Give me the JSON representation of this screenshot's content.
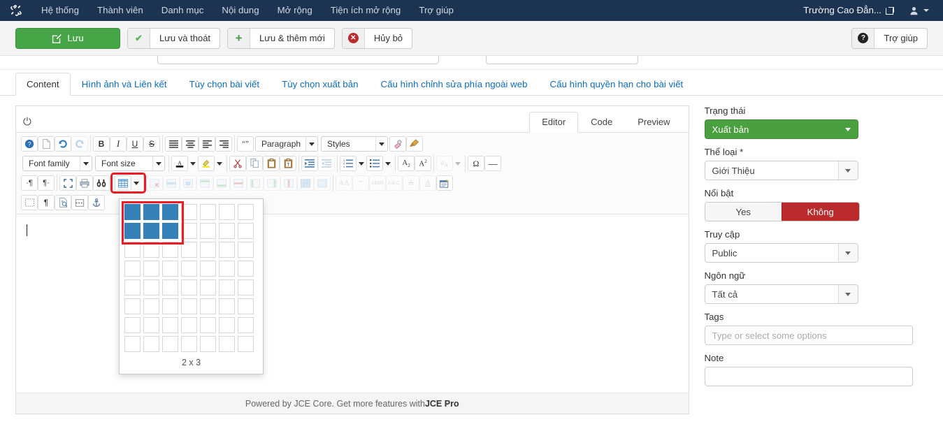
{
  "topbar": {
    "logo_icon": "joomla-logo-icon",
    "menu": [
      {
        "label": "Hệ thống"
      },
      {
        "label": "Thành viên"
      },
      {
        "label": "Danh mục"
      },
      {
        "label": "Nội dung"
      },
      {
        "label": "Mở rộng"
      },
      {
        "label": "Tiện ích mở rộng"
      },
      {
        "label": "Trợ giúp"
      }
    ],
    "site_name": "Trường Cao Đẳn...",
    "site_link_icon": "external-link-icon",
    "user_icon": "user-icon"
  },
  "toolbar": {
    "save_label": "Lưu",
    "save_close_label": "Lưu và thoát",
    "save_new_label": "Lưu & thêm mới",
    "cancel_label": "Hủy bỏ",
    "help_label": "Trợ giúp",
    "save_icon": "pencil-square-icon",
    "save_close_icon": "check-icon",
    "save_new_icon": "plus-icon",
    "cancel_icon": "cancel-circle-icon",
    "help_icon": "question-circle-icon",
    "accent_green": "#46a546",
    "accent_red": "#bb2b2b"
  },
  "tabs": [
    {
      "label": "Content",
      "active": true
    },
    {
      "label": "Hình ảnh và Liên kết",
      "active": false
    },
    {
      "label": "Tùy chọn bài viết",
      "active": false
    },
    {
      "label": "Tùy chọn xuất bản",
      "active": false
    },
    {
      "label": "Cấu hình chỉnh sửa phía ngoài web",
      "active": false
    },
    {
      "label": "Cấu hình quyền hạn cho bài viết",
      "active": false
    }
  ],
  "editor": {
    "power_icon": "power-toggle-icon",
    "mode_tabs": [
      {
        "label": "Editor",
        "active": true
      },
      {
        "label": "Code",
        "active": false
      },
      {
        "label": "Preview",
        "active": false
      }
    ],
    "selects": {
      "paragraph": "Paragraph",
      "styles": "Styles",
      "font_family": "Font family",
      "font_size": "Font size"
    },
    "footer_text": "Powered by JCE Core. Get more features with ",
    "footer_link": "JCE Pro",
    "content": "",
    "toolbar_rows": [
      {
        "buttons": [
          "help-icon",
          "new-document-icon",
          "undo-icon",
          "redo-icon",
          "bold-icon",
          "italic-icon",
          "underline-icon",
          "strikethrough-icon",
          "align-justify-icon",
          "align-center-icon",
          "align-left-icon",
          "align-right-icon",
          "blockquote-icon",
          "paragraph-select",
          "styles-select",
          "remove-format-icon",
          "clean-up-icon"
        ]
      },
      {
        "buttons": [
          "font-family-select",
          "font-size-select",
          "forecolor-icon",
          "forecolor-caret",
          "backcolor-icon",
          "backcolor-caret",
          "cut-icon",
          "copy-icon",
          "paste-icon",
          "paste-text-icon",
          "indent-icon",
          "outdent-icon",
          "numbered-list-icon",
          "numbered-list-caret",
          "bullet-list-icon",
          "bullet-list-caret",
          "subscript-icon",
          "superscript-icon",
          "spellcheck-icon",
          "spellcheck-caret",
          "charmap-icon",
          "horizontal-rule-icon"
        ]
      },
      {
        "buttons": [
          "ltr-icon",
          "rtl-icon",
          "fullscreen-icon",
          "print-icon",
          "search-replace-icon",
          "table-icon",
          "table-caret",
          "delete-table-icon",
          "row-properties-icon",
          "cell-properties-icon",
          "insert-row-before-icon",
          "insert-row-after-icon",
          "delete-row-icon",
          "insert-col-before-icon",
          "insert-col-after-icon",
          "delete-col-icon",
          "merge-cells-icon",
          "split-cells-icon",
          "style-select-icon",
          "quote-icon",
          "abbr-icon",
          "acronym-icon",
          "delete-text-icon",
          "insert-text-icon",
          "article-icon"
        ]
      },
      {
        "buttons": [
          "visual-blocks-icon",
          "pilcrow-icon",
          "preview-page-icon",
          "page-break-icon",
          "anchor-icon"
        ]
      }
    ],
    "table_picker": {
      "rows": 8,
      "cols": 7,
      "selected_rows": 2,
      "selected_cols": 3,
      "label": "2 x 3",
      "highlight_color": "#3580b8",
      "annotation_color": "#ec1c24"
    }
  },
  "sidebar": {
    "status": {
      "label": "Trạng thái",
      "value": "Xuất bản"
    },
    "category": {
      "label": "Thể loại *",
      "value": "Giới Thiệu"
    },
    "featured": {
      "label": "Nổi bật",
      "yes_label": "Yes",
      "no_label": "Không",
      "selected": "Không"
    },
    "access": {
      "label": "Truy cập",
      "value": "Public"
    },
    "language": {
      "label": "Ngôn ngữ",
      "value": "Tất cả"
    },
    "tags": {
      "label": "Tags",
      "value": "",
      "placeholder": "Type or select some options"
    },
    "note": {
      "label": "Note",
      "value": ""
    }
  }
}
